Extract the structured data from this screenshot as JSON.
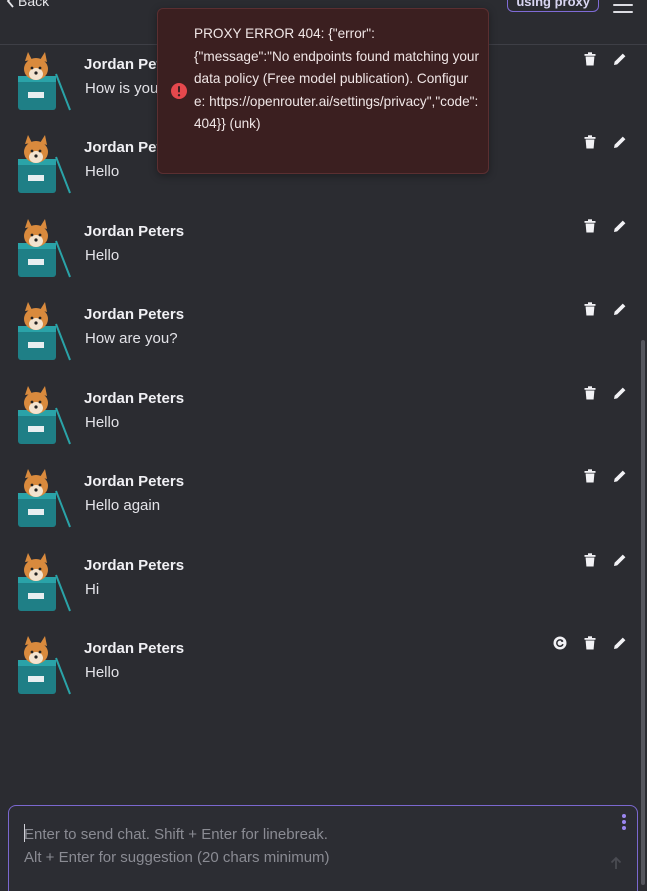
{
  "topbar": {
    "back_label": "Back",
    "proxy_badge": "using proxy"
  },
  "error": {
    "message": "PROXY ERROR 404: {\"error\":\n{\"message\":\"No endpoints found matching your data policy (Free model publication). Configure: https://openrouter.ai/settings/privacy\",\"code\":404}} (unk)"
  },
  "messages": [
    {
      "name": "Jordan Peters",
      "text": "How is you"
    },
    {
      "name": "Jordan Peters",
      "text": "Hello"
    },
    {
      "name": "Jordan Peters",
      "text": "Hello"
    },
    {
      "name": "Jordan Peters",
      "text": "How are you?"
    },
    {
      "name": "Jordan Peters",
      "text": "Hello"
    },
    {
      "name": "Jordan Peters",
      "text": "Hello again"
    },
    {
      "name": "Jordan Peters",
      "text": "Hi"
    },
    {
      "name": "Jordan Peters",
      "text": "Hello"
    }
  ],
  "input": {
    "placeholder": "Enter to send chat. Shift + Enter for linebreak.\nAlt + Enter for suggestion (20 chars minimum)"
  },
  "icons": {
    "back": "chevron-left-icon",
    "delete": "trash-icon",
    "edit": "pencil-icon",
    "regenerate": "refresh-icon",
    "error": "error-circle-icon",
    "send": "arrow-up-icon",
    "more": "vertical-dots-icon"
  },
  "colors": {
    "background": "#2b2c31",
    "accent": "#7b68cf",
    "error_bg": "#3b1f20",
    "error_icon": "#e5484d"
  }
}
